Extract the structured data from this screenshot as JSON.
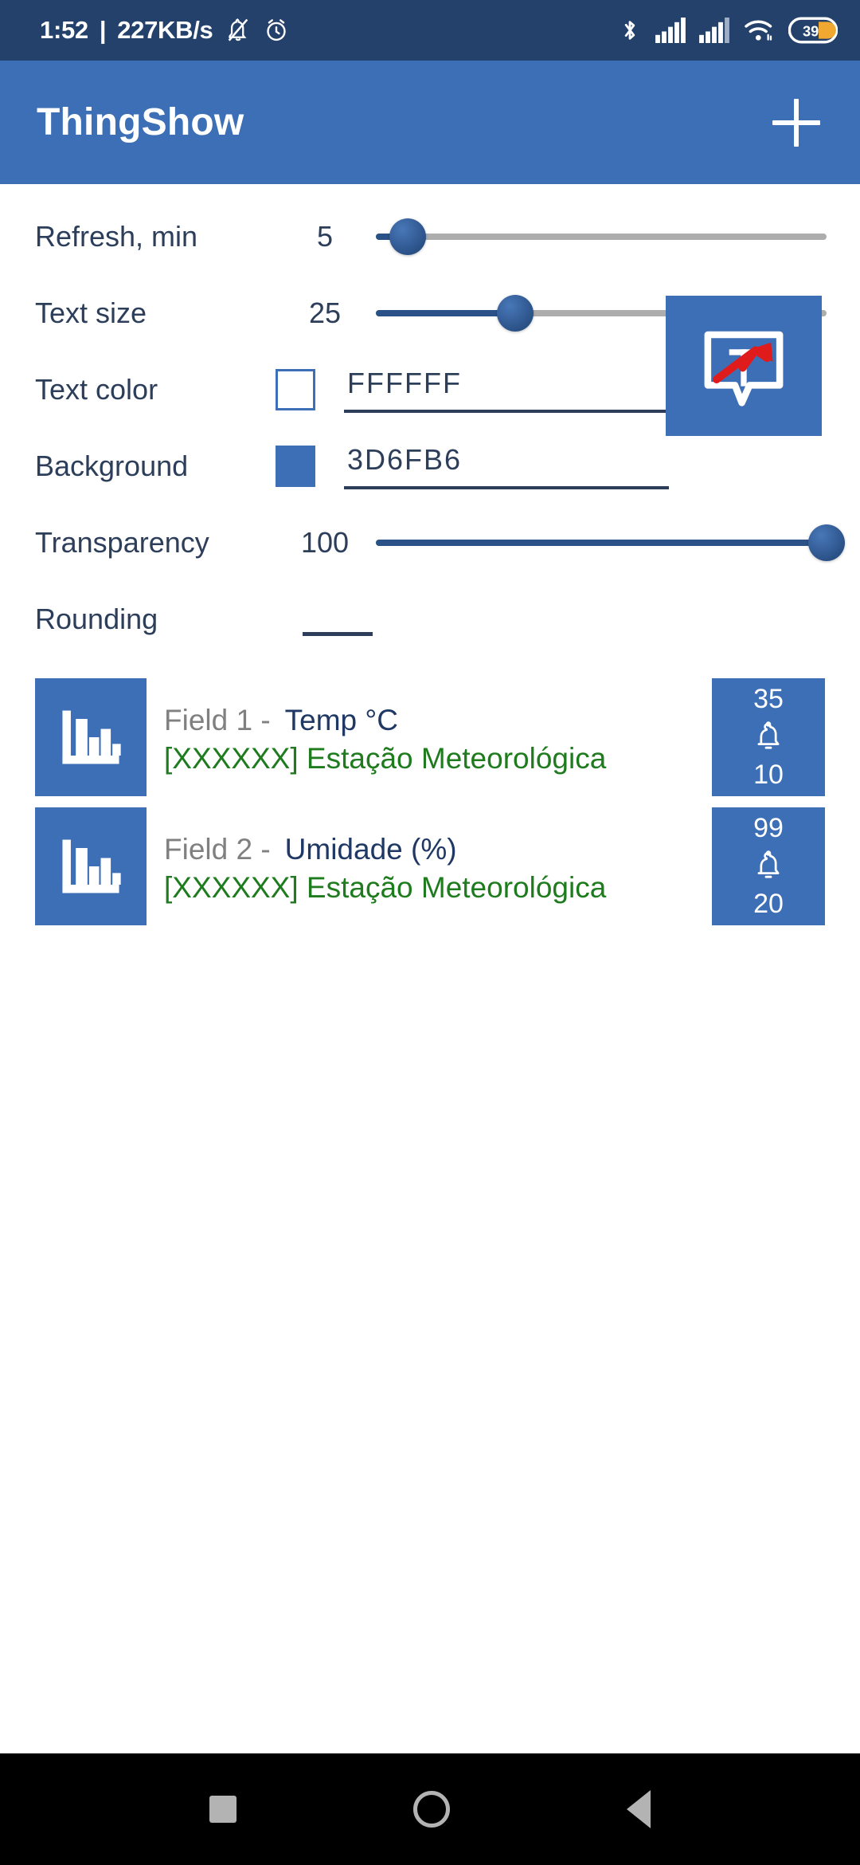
{
  "status_bar": {
    "clock": "1:52",
    "separator": "|",
    "network_speed": "227KB/s",
    "icons_left": [
      "bell-off-icon",
      "alarm-icon"
    ],
    "icons_right": [
      "bluetooth-icon",
      "signal-sim1-icon",
      "signal-sim2-icon",
      "wifi-icon",
      "battery-icon"
    ],
    "battery_percent": "39",
    "background_color": "#23416A"
  },
  "app_bar": {
    "title": "ThingShow",
    "add_button_label": "+",
    "background_color": "#3D6FB6"
  },
  "settings": {
    "refresh": {
      "label": "Refresh, min",
      "value": "5",
      "slider_percent": 7
    },
    "text_size": {
      "label": "Text size",
      "value": "25",
      "slider_percent": 31
    },
    "text_color": {
      "label": "Text color",
      "value": "FFFFFF",
      "swatch_color": "#FFFFFF"
    },
    "background": {
      "label": "Background",
      "value": "3D6FB6",
      "swatch_color": "#3D6FB6"
    },
    "transparency": {
      "label": "Transparency",
      "value": "100",
      "slider_percent": 100
    },
    "rounding": {
      "label": "Rounding",
      "value": ""
    },
    "preview_icon": "thingshow-app-icon"
  },
  "cards": [
    {
      "icon": "bar-chart-icon",
      "field_number": "Field 1 -",
      "field_name": "Temp °C",
      "channel": "[XXXXXX] Estação Meteorológica",
      "max_value": "35",
      "alarm_icon": "bell-icon",
      "min_value": "10"
    },
    {
      "icon": "bar-chart-icon",
      "field_number": "Field 2 -",
      "field_name": "Umidade (%)",
      "channel": "[XXXXXX] Estação Meteorológica",
      "max_value": "99",
      "alarm_icon": "bell-icon",
      "min_value": "20"
    }
  ],
  "nav_bar": {
    "recents_label": "recents-square-icon",
    "home_label": "home-circle-icon",
    "back_label": "back-triangle-icon"
  }
}
